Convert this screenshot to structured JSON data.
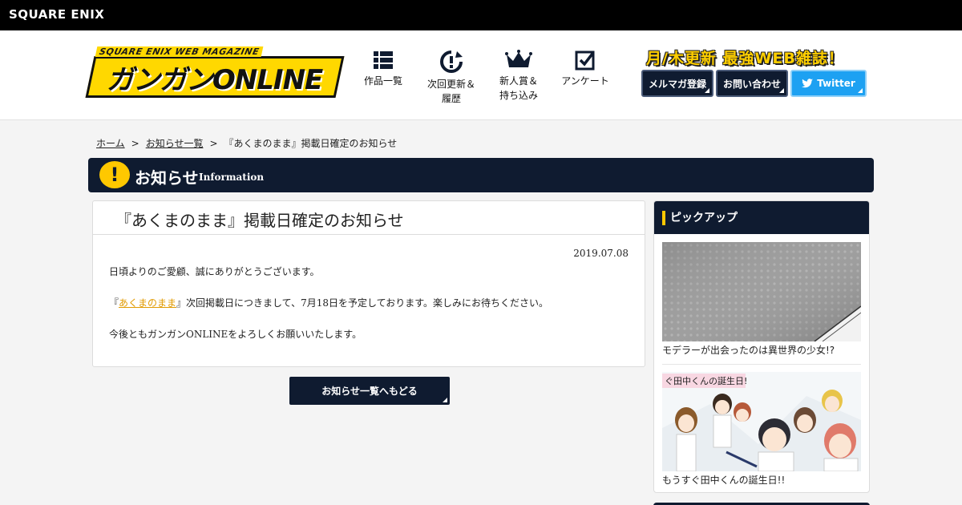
{
  "brand": "SQUARE ENIX",
  "logo": {
    "subtitle": "SQUARE ENIX WEB MAGAZINE",
    "title": "ガンガンONLINE"
  },
  "nav": [
    {
      "label": "作品一覧"
    },
    {
      "label": "次回更新＆",
      "label2": "履歴"
    },
    {
      "label": "新人賞＆",
      "label2": "持ち込み"
    },
    {
      "label": "アンケート"
    }
  ],
  "tagline": "月/木更新 最強WEB雑誌！",
  "header_buttons": {
    "mailmag": "メルマガ登録",
    "contact": "お問い合わせ",
    "twitter": "Twitter"
  },
  "breadcrumb": {
    "home": "ホーム",
    "list": "お知らせ一覧",
    "current": "『あくまのまま』掲載日確定のお知らせ",
    "sep": ">"
  },
  "section": {
    "title": "お知らせ",
    "subtitle": "Information",
    "icon": "exclamation-icon"
  },
  "article": {
    "title": "『あくまのまま』掲載日確定のお知らせ",
    "date": "2019.07.08",
    "p1": "日頃よりのご愛顧、誠にありがとうございます。",
    "p2_pre": "『",
    "p2_link": "あくまのまま",
    "p2_post": "』次回掲載日につきまして、7月18日を予定しております。楽しみにお待ちください。",
    "p3": "今後ともガンガンONLINEをよろしくお願いいたします。"
  },
  "back_button": "お知らせ一覧へもどる",
  "sidebar": {
    "title": "ピックアップ",
    "items": [
      {
        "caption": "モデラーが出会ったのは異世界の少女!?"
      },
      {
        "caption": "もうすぐ田中くんの誕生日!!",
        "banner_text": "ぐ田中くんの誕生日!"
      }
    ]
  },
  "colors": {
    "navy": "#0f1b30",
    "accent": "#ffc800",
    "link": "#e19a00",
    "twitter": "#1da1f2"
  }
}
